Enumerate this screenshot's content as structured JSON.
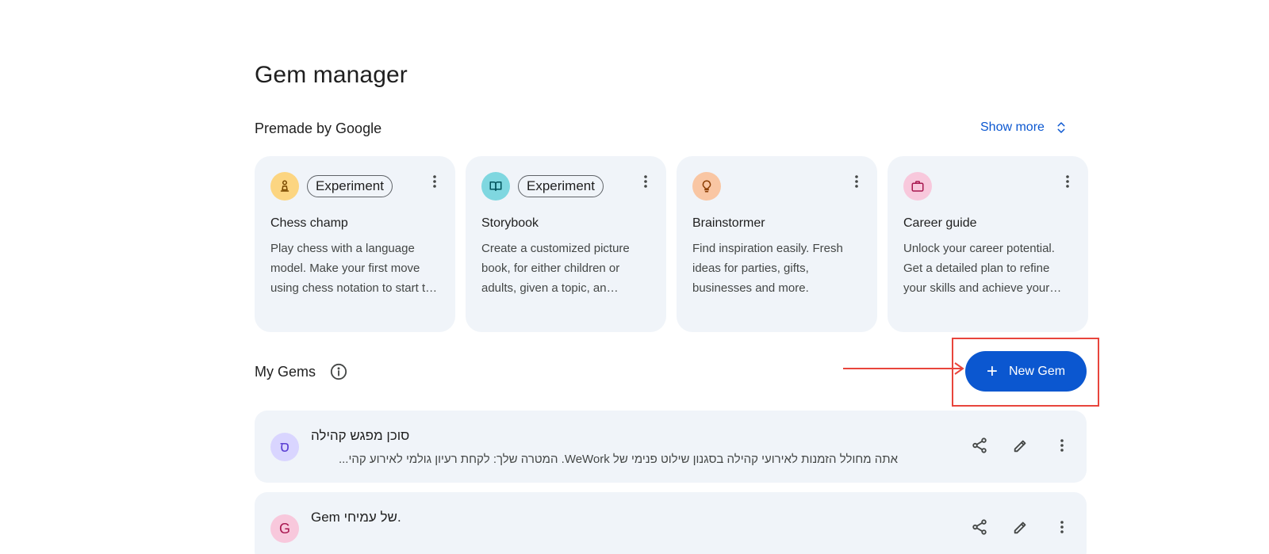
{
  "page": {
    "title": "Gem manager"
  },
  "premade": {
    "title": "Premade by Google",
    "show_more_label": "Show more",
    "cards": [
      {
        "name": "Chess champ",
        "badge": "Experiment",
        "icon": "chess-pawn-icon",
        "icon_bg": "#fcd581",
        "description": "Play chess with a language model. Make your first move using chess notation to start the game."
      },
      {
        "name": "Storybook",
        "badge": "Experiment",
        "icon": "open-book-icon",
        "icon_bg": "#7fd7e0",
        "description": "Create a customized picture book, for either children or adults, given a topic, an audience, and a style."
      },
      {
        "name": "Brainstormer",
        "badge": "",
        "icon": "lightbulb-icon",
        "icon_bg": "#f9c6a3",
        "description": "Find inspiration easily. Fresh ideas for parties, gifts, businesses and more."
      },
      {
        "name": "Career guide",
        "badge": "",
        "icon": "briefcase-icon",
        "icon_bg": "#f8c8dc",
        "description": "Unlock your career potential. Get a detailed plan to refine your skills and achieve your goals."
      }
    ]
  },
  "my_gems": {
    "title": "My Gems",
    "new_gem_label": "New Gem",
    "items": [
      {
        "avatar": "ס",
        "avatar_bg": "#d9d5ff",
        "avatar_color": "#5b3fd3",
        "name": "סוכן מפגש קהילה",
        "description": "אתה מחולל הזמנות לאירועי קהילה בסגנון שילוט פנימי של WeWork. המטרה שלך: לקחת רעיון גולמי לאירוע קהי..."
      },
      {
        "avatar": "G",
        "avatar_bg": "#f8c8dc",
        "avatar_color": "#a8174f",
        "name": "Gem של עמיחי.",
        "description": ""
      }
    ]
  },
  "colors": {
    "accent": "#0b57d0",
    "card_bg": "#f0f4f9",
    "annotation": "#e8453c"
  }
}
